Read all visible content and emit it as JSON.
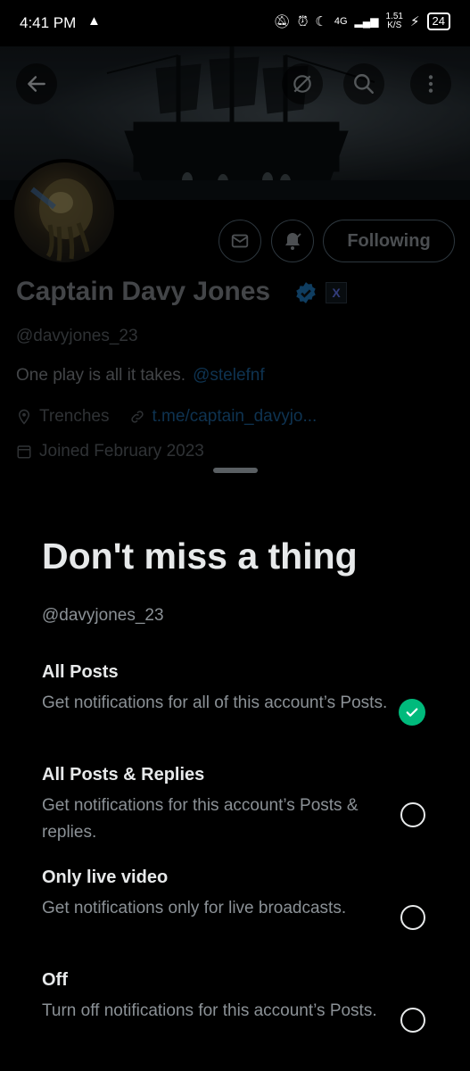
{
  "status_bar": {
    "time": "4:41 PM",
    "warning_icon": "warning-icon",
    "network": "4G",
    "speed": "1.51",
    "speed_unit": "K/S",
    "battery": "24"
  },
  "header": {
    "back_icon": "back-arrow-icon",
    "grok_icon": "grok-icon",
    "search_icon": "search-icon",
    "more_icon": "more-icon"
  },
  "profile": {
    "follow_state": "Following",
    "name": "Captain Davy Jones",
    "handle": "@davyjones_23",
    "bio_text": "One play is all it takes.",
    "bio_mention": "@stelefnf",
    "location": "Trenches",
    "link": "t.me/captain_davyjo...",
    "joined": "Joined February 2023"
  },
  "sheet": {
    "title": "Don't miss a thing",
    "handle": "@davyjones_23",
    "options": [
      {
        "label": "All Posts",
        "desc": "Get notifications for all of this account’s Posts.",
        "selected": true
      },
      {
        "label": "All Posts & Replies",
        "desc": "Get notifications for this account’s Posts & replies.",
        "selected": false
      },
      {
        "label": "Only live video",
        "desc": "Get notifications only for live broadcasts.",
        "selected": false
      },
      {
        "label": "Off",
        "desc": "Turn off notifications for this account’s Posts.",
        "selected": false
      }
    ]
  },
  "colors": {
    "accent_green": "#00ba7c",
    "link_blue": "#1d9bf0",
    "background": "#000000"
  }
}
